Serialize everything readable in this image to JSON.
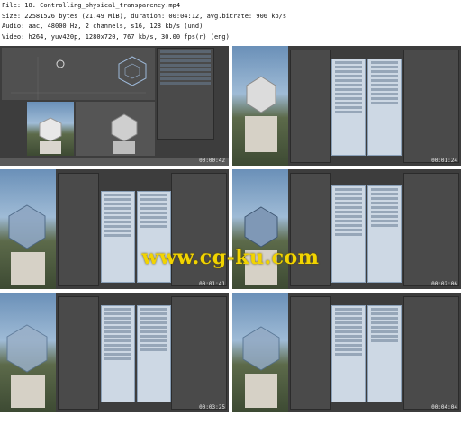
{
  "header": {
    "file_line": "File: 18. Controlling_physical_transparency.mp4",
    "size_line": "Size: 22581526 bytes (21.49 MiB), duration: 00:04:12, avg.bitrate: 906 kb/s",
    "audio_line": "Audio: aac, 48000 Hz, 2 channels, s16, 128 kb/s (und)",
    "video_line": "Video: h264, yuv420p, 1280x720, 767 kb/s, 30.00 fps(r) (eng)"
  },
  "watermark": "www.cg-ku.com",
  "tiles": [
    {
      "timestamp": "00:00:42"
    },
    {
      "timestamp": "00:01:24"
    },
    {
      "timestamp": "00:01:41"
    },
    {
      "timestamp": "00:02:06"
    },
    {
      "timestamp": "00:03:25"
    },
    {
      "timestamp": "00:04:04"
    }
  ]
}
